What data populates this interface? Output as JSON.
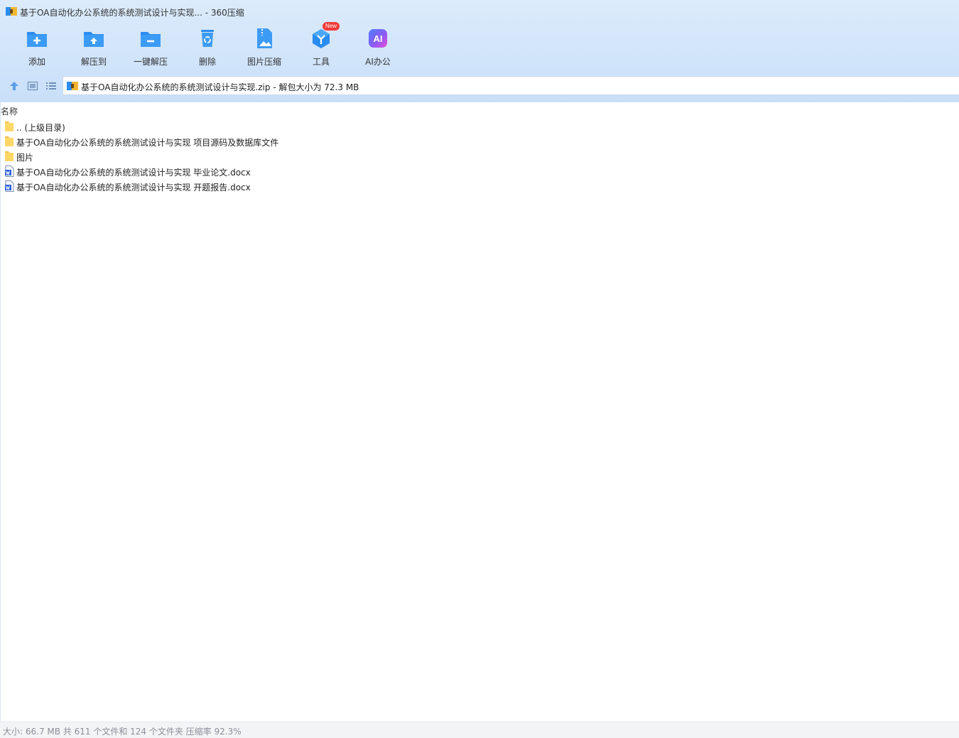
{
  "window": {
    "title": "基于OA自动化办公系统的系统测试设计与实现... - 360压缩"
  },
  "toolbar": {
    "add_label": "添加",
    "extract_to_label": "解压到",
    "one_click_extract_label": "一键解压",
    "delete_label": "删除",
    "image_compress_label": "图片压缩",
    "tools_label": "工具",
    "tools_badge": "New",
    "ai_office_label": "AI办公",
    "ai_icon_text": "AI"
  },
  "path": {
    "text": "基于OA自动化办公系统的系统测试设计与实现.zip - 解包大小为 72.3 MB"
  },
  "list": {
    "column_name": "名称",
    "items": [
      {
        "type": "folder",
        "name": ".. (上级目录)"
      },
      {
        "type": "folder",
        "name": "基于OA自动化办公系统的系统测试设计与实现 项目源码及数据库文件"
      },
      {
        "type": "folder",
        "name": "图片"
      },
      {
        "type": "docx",
        "name": "基于OA自动化办公系统的系统测试设计与实现 毕业论文.docx"
      },
      {
        "type": "docx",
        "name": "基于OA自动化办公系统的系统测试设计与实现 开题报告.docx"
      }
    ]
  },
  "status": {
    "text": "大小: 66.7 MB 共 611 个文件和 124 个文件夹 压缩率 92.3%"
  },
  "colors": {
    "accent_blue": "#2a8cf0",
    "folder_yellow": "#ffd766",
    "word_blue": "#2b5fd9",
    "badge_red": "#f03a3a"
  }
}
